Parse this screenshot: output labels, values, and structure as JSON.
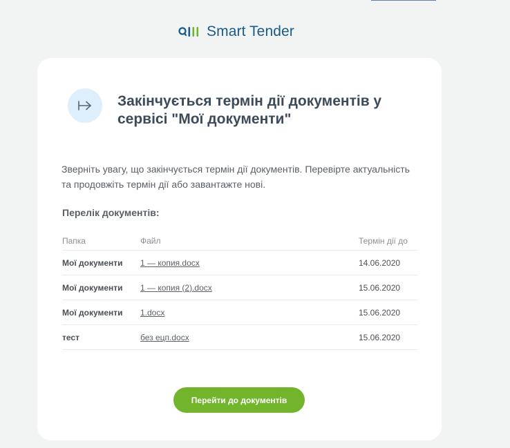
{
  "brand": {
    "name": "Smart Tender",
    "color": "#1a5a87",
    "logo_accent_color": "#72b42c"
  },
  "card": {
    "header_icon": "arrow-to-line-right-icon",
    "title": "Закінчується термін дії документів у сервісі \"Мої документи\"",
    "intro": "Зверніть увагу, що закінчується термін дії документів. Перевірте актуальність та продовжіть термін дії або завантажте нові.",
    "list_title": "Перелік документів:",
    "table": {
      "headers": [
        "Папка",
        "Файл",
        "Термін дії до"
      ],
      "rows": [
        {
          "folder": "Мої документи",
          "file": "1 — копия.docx",
          "expires": "14.06.2020"
        },
        {
          "folder": "Мої документи",
          "file": "1 — копия (2).docx",
          "expires": "15.06.2020"
        },
        {
          "folder": "Мої документи",
          "file": "1.docx",
          "expires": "15.06.2020"
        },
        {
          "folder": "тест",
          "file": "без ецп.docx",
          "expires": "15.06.2020"
        }
      ]
    },
    "button_label": "Перейти до документів",
    "button_color": "#72b42c"
  }
}
